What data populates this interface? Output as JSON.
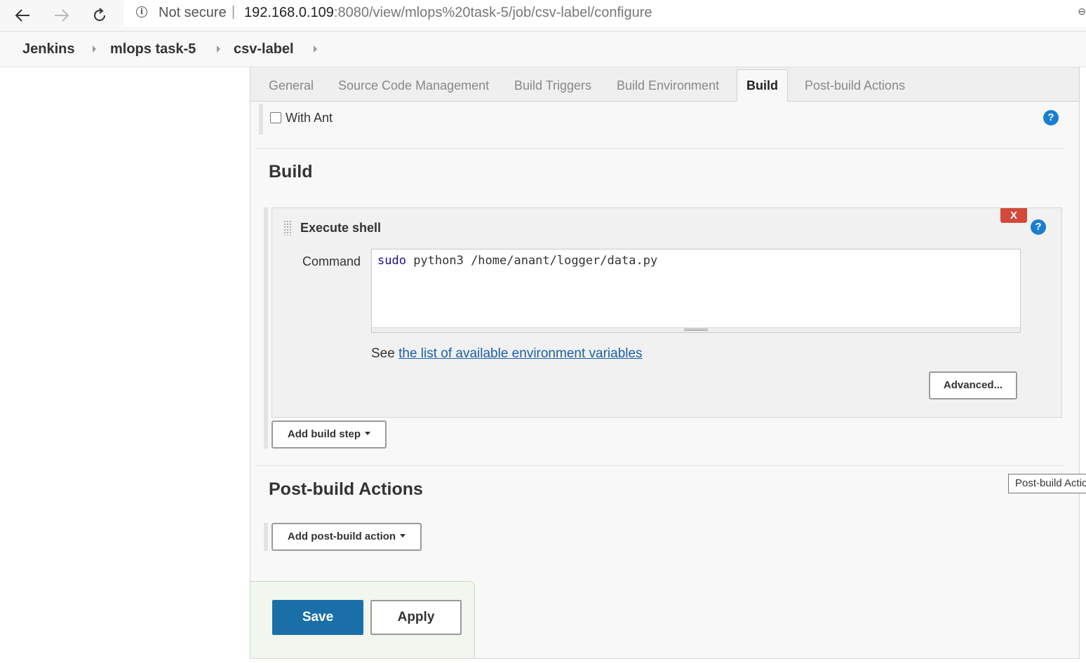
{
  "browser": {
    "security_label": "Not secure",
    "separator": "|",
    "url_host": "192.168.0.109",
    "url_path": ":8080/view/mlops%20task-5/job/csv-label/configure"
  },
  "breadcrumb": [
    "Jenkins",
    "mlops task-5",
    "csv-label"
  ],
  "tabs": [
    {
      "label": "General"
    },
    {
      "label": "Source Code Management"
    },
    {
      "label": "Build Triggers"
    },
    {
      "label": "Build Environment"
    },
    {
      "label": "Build",
      "active": true
    },
    {
      "label": "Post-build Actions"
    }
  ],
  "build_environment": {
    "with_ant_label": "With Ant",
    "with_ant_checked": false
  },
  "build": {
    "title": "Build",
    "step": {
      "title": "Execute shell",
      "delete_label": "X",
      "command_label": "Command",
      "command_keyword": "sudo",
      "command_rest": " python3 /home/anant/logger/data.py",
      "env_prefix": "See ",
      "env_link": "the list of available environment variables",
      "advanced_label": "Advanced..."
    },
    "add_step_label": "Add build step"
  },
  "post_build": {
    "title": "Post-build Actions",
    "add_action_label": "Add post-build action",
    "tooltip": "Post-build Actions"
  },
  "footer": {
    "save_label": "Save",
    "apply_label": "Apply"
  },
  "help_glyph": "?",
  "colors": {
    "primary": "#1b6fa8",
    "help": "#1a7ed0",
    "delete": "#d24939",
    "link": "#1b5fa6"
  }
}
